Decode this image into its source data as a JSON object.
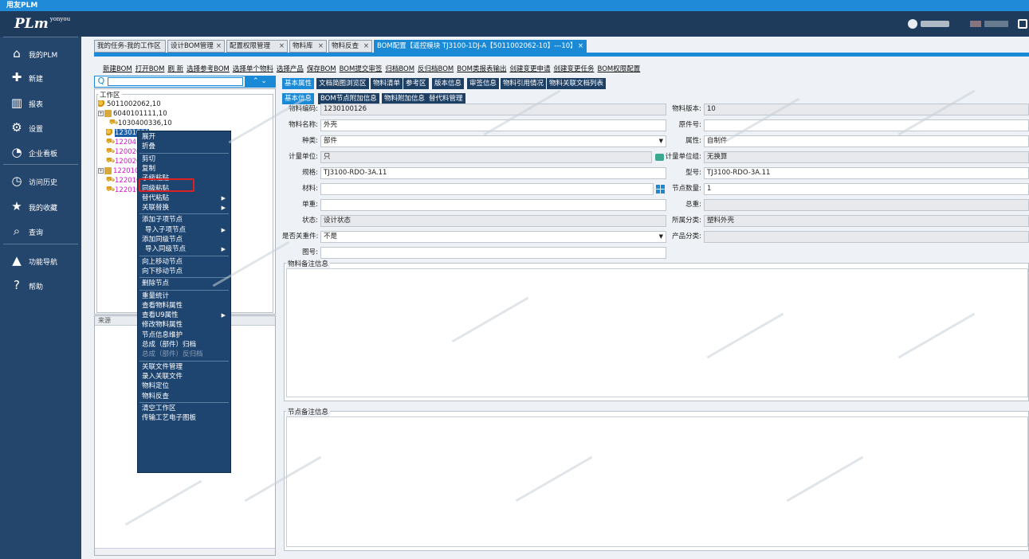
{
  "app_title": "用友PLM",
  "logo": {
    "text": "PLm",
    "sup": "yonyou"
  },
  "sidebar": {
    "items": [
      {
        "label": "我的PLM",
        "icon": "home-icon"
      },
      {
        "label": "新建",
        "icon": "new-doc-icon"
      },
      {
        "label": "报表",
        "icon": "bar-chart-icon"
      },
      {
        "label": "设置",
        "icon": "gear-icon"
      },
      {
        "label": "企业看板",
        "icon": "pie-chart-icon"
      },
      {
        "label": "访问历史",
        "icon": "history-icon"
      },
      {
        "label": "我的收藏",
        "icon": "star-icon"
      },
      {
        "label": "查询",
        "icon": "search-icon"
      },
      {
        "label": "功能导航",
        "icon": "navigation-icon"
      },
      {
        "label": "帮助",
        "icon": "help-icon"
      }
    ]
  },
  "tabs": [
    {
      "label": "我的任务-我的工作区"
    },
    {
      "label": "设计BOM管理",
      "close": "×"
    },
    {
      "label": "配置权限管理",
      "close": "×"
    },
    {
      "label": "物料库",
      "close": "×"
    },
    {
      "label": "物料反查",
      "close": "×"
    },
    {
      "label": "BOM配置【遥控模块  TJ3100-1DJ-A【5011002062-10】---10】",
      "close": "×"
    }
  ],
  "toolbar": [
    "新建BOM",
    "打开BOM",
    "刷 新",
    "选择参考BOM",
    "选择单个物料",
    "选择产品",
    "保存BOM",
    "BOM提交审签",
    "归档BOM",
    "反归档BOM",
    "BOM类报表输出",
    "创建变更申请",
    "创建变更任务",
    "BOM权限配置"
  ],
  "search": {
    "icon": "Q",
    "buttons": "⌃ ⌄"
  },
  "tree": {
    "group_title": "工作区",
    "nodes": [
      {
        "text": "5011002062,10",
        "icon": "key"
      },
      {
        "text": "6040101111,10",
        "icon": "box",
        "expander": "+"
      },
      {
        "text": "1030400336,10",
        "icon": "cart"
      },
      {
        "text": "12301001",
        "icon": "key"
      },
      {
        "text": "1220410",
        "icon": "cart"
      },
      {
        "text": "1200201",
        "icon": "cart"
      },
      {
        "text": "1200202",
        "icon": "cart"
      },
      {
        "text": "1220101",
        "icon": "box",
        "expander": "+"
      },
      {
        "text": "1220102",
        "icon": "cart"
      },
      {
        "text": "1220103",
        "icon": "cart"
      }
    ]
  },
  "bottom_panel": {
    "header": "来源"
  },
  "context_menu": [
    {
      "label": "展开"
    },
    {
      "label": "折叠"
    },
    {
      "sep": true
    },
    {
      "label": "剪切"
    },
    {
      "label": "复制"
    },
    {
      "label": "子级粘贴"
    },
    {
      "label": "同级粘贴"
    },
    {
      "label": "替代粘贴",
      "submenu": true
    },
    {
      "label": "关联替换",
      "submenu": true
    },
    {
      "sep": true
    },
    {
      "label": "添加子项节点"
    },
    {
      "label": "导入子项节点",
      "submenu": true,
      "indent": true
    },
    {
      "label": "添加同级节点"
    },
    {
      "label": "导入同级节点",
      "submenu": true,
      "indent": true
    },
    {
      "sep": true
    },
    {
      "label": "向上移动节点"
    },
    {
      "label": "向下移动节点"
    },
    {
      "sep": true
    },
    {
      "label": "删除节点"
    },
    {
      "sep": true
    },
    {
      "label": "重量统计"
    },
    {
      "label": "查看物料属性"
    },
    {
      "label": "查看U9属性",
      "submenu": true
    },
    {
      "label": "修改物料属性"
    },
    {
      "label": "节点信息维护"
    },
    {
      "label": "总成（部件）归档"
    },
    {
      "label": "总成（部件）反归档",
      "disabled": true
    },
    {
      "sep": true
    },
    {
      "label": "关联文件管理"
    },
    {
      "label": "录入关联文件"
    },
    {
      "label": "物料定位"
    },
    {
      "label": "物料反查"
    },
    {
      "sep": true
    },
    {
      "label": "清空工作区"
    },
    {
      "label": "传输工艺电子图板"
    }
  ],
  "subtabs_row1": [
    "基本属性",
    "文档简图浏览区",
    "物料清单",
    "参考区",
    "版本信息",
    "审签信息",
    "物料引用情况",
    "物料关联文档列表"
  ],
  "subtabs_row2": [
    "基本信息",
    "BOM节点附加信息",
    "物料附加信息",
    "替代料管理"
  ],
  "form": {
    "left": [
      {
        "label": "物料编码:",
        "value": "1230100126",
        "readonly": true
      },
      {
        "label": "物料名称:",
        "value": "外壳"
      },
      {
        "label": "种类:",
        "value": "部件",
        "dropdown": true
      },
      {
        "label": "计量单位:",
        "value": "只",
        "readonly": true
      },
      {
        "label": "规格:",
        "value": "TJ3100-RDO-3A.11"
      },
      {
        "label": "材料:",
        "value": ""
      },
      {
        "label": "单重:",
        "value": ""
      },
      {
        "label": "状态:",
        "value": "设计状态",
        "readonly": true
      },
      {
        "label": "是否关重件:",
        "value": "不是",
        "dropdown": true
      },
      {
        "label": "图号:",
        "value": ""
      }
    ],
    "right": [
      {
        "label": "物料版本:",
        "value": "10",
        "readonly": true
      },
      {
        "label": "原件号:",
        "value": ""
      },
      {
        "label": "属性:",
        "value": "自制件"
      },
      {
        "label": "计量单位组:",
        "value": "无换算",
        "readonly": true
      },
      {
        "label": "型号:",
        "value": "TJ3100-RDO-3A.11"
      },
      {
        "label": "节点数量:",
        "value": "1"
      },
      {
        "label": "总重:",
        "value": "",
        "readonly": true
      },
      {
        "label": "所属分类:",
        "value": "塑料外壳",
        "readonly": true
      },
      {
        "label": "产品分类:",
        "value": "",
        "readonly": true
      }
    ]
  },
  "sections": {
    "material_remark": "物料备注信息",
    "node_remark": "节点备注信息"
  },
  "colors": {
    "accent": "#1a8ad6",
    "sidebar": "#24466c",
    "header": "#1e3b5c",
    "menu": "#1e4570",
    "highlight": "#e02020"
  }
}
